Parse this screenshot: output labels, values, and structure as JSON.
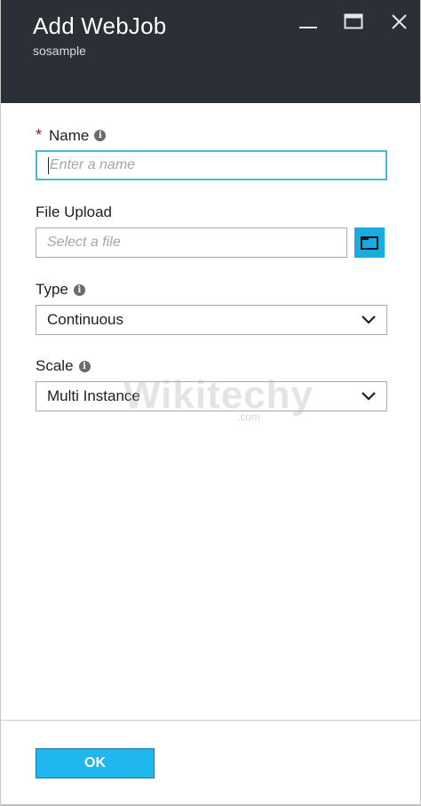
{
  "header": {
    "title": "Add WebJob",
    "subtitle": "sosample",
    "background_color": "#2b2f36",
    "controls": [
      "minimize-icon",
      "maximize-icon",
      "close-icon"
    ]
  },
  "form": {
    "name": {
      "label": "Name",
      "required_marker": "*",
      "placeholder": "Enter a name",
      "value": ""
    },
    "file_upload": {
      "label": "File Upload",
      "placeholder": "Select a file",
      "browse_icon": "folder-icon"
    },
    "type": {
      "label": "Type",
      "selected": "Continuous"
    },
    "scale": {
      "label": "Scale",
      "selected": "Multi Instance"
    }
  },
  "watermark": {
    "text": "Wikitechy",
    "sub": ".com"
  },
  "footer": {
    "ok_label": "OK",
    "accent_color": "#1fb7ee"
  }
}
